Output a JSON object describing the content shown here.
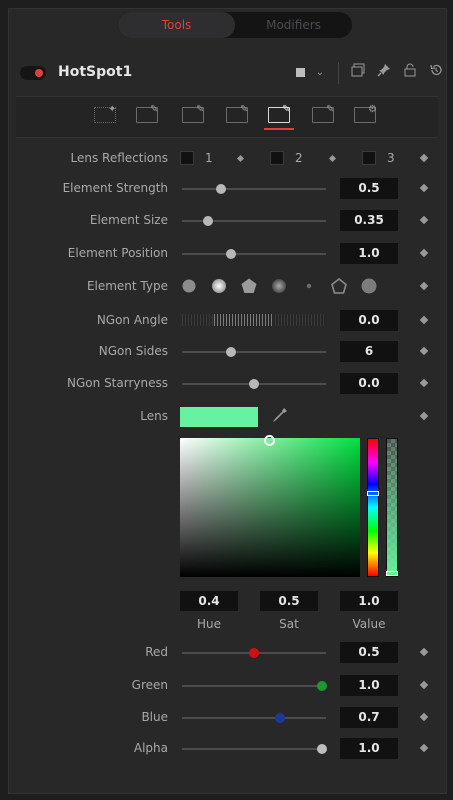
{
  "tabs": {
    "tools": "Tools",
    "modifiers": "Modifiers"
  },
  "header": {
    "node_name": "HotSpot1"
  },
  "params": {
    "lens_reflections": {
      "label": "Lens Reflections",
      "options": [
        "1",
        "2",
        "3"
      ]
    },
    "element_strength": {
      "label": "Element Strength",
      "value": "0.5",
      "level": 0.27
    },
    "element_size": {
      "label": "Element Size",
      "value": "0.35",
      "level": 0.18
    },
    "element_position": {
      "label": "Element Position",
      "value": "1.0",
      "level": 0.34
    },
    "element_type": {
      "label": "Element Type"
    },
    "ngon_angle": {
      "label": "NGon Angle",
      "value": "0.0"
    },
    "ngon_sides": {
      "label": "NGon Sides",
      "value": "6",
      "level": 0.34
    },
    "ngon_starryness": {
      "label": "NGon Starryness",
      "value": "0.0",
      "level": 0.5
    },
    "lens": {
      "label": "Lens",
      "color": "#66f2a0"
    }
  },
  "hsv": {
    "hue": {
      "label": "Hue",
      "value": "0.4"
    },
    "sat": {
      "label": "Sat",
      "value": "0.5"
    },
    "value": {
      "label": "Value",
      "value": "1.0"
    }
  },
  "rgba": {
    "red": {
      "label": "Red",
      "value": "0.5",
      "level": 0.5,
      "color": "#d01010"
    },
    "green": {
      "label": "Green",
      "value": "1.0",
      "level": 0.97,
      "color": "#1a9a2a"
    },
    "blue": {
      "label": "Blue",
      "value": "0.7",
      "level": 0.68,
      "color": "#1a3a9a"
    },
    "alpha": {
      "label": "Alpha",
      "value": "1.0",
      "level": 0.97,
      "color": "#bdbdbd"
    }
  },
  "colors": {
    "accent": "#e0403a"
  }
}
